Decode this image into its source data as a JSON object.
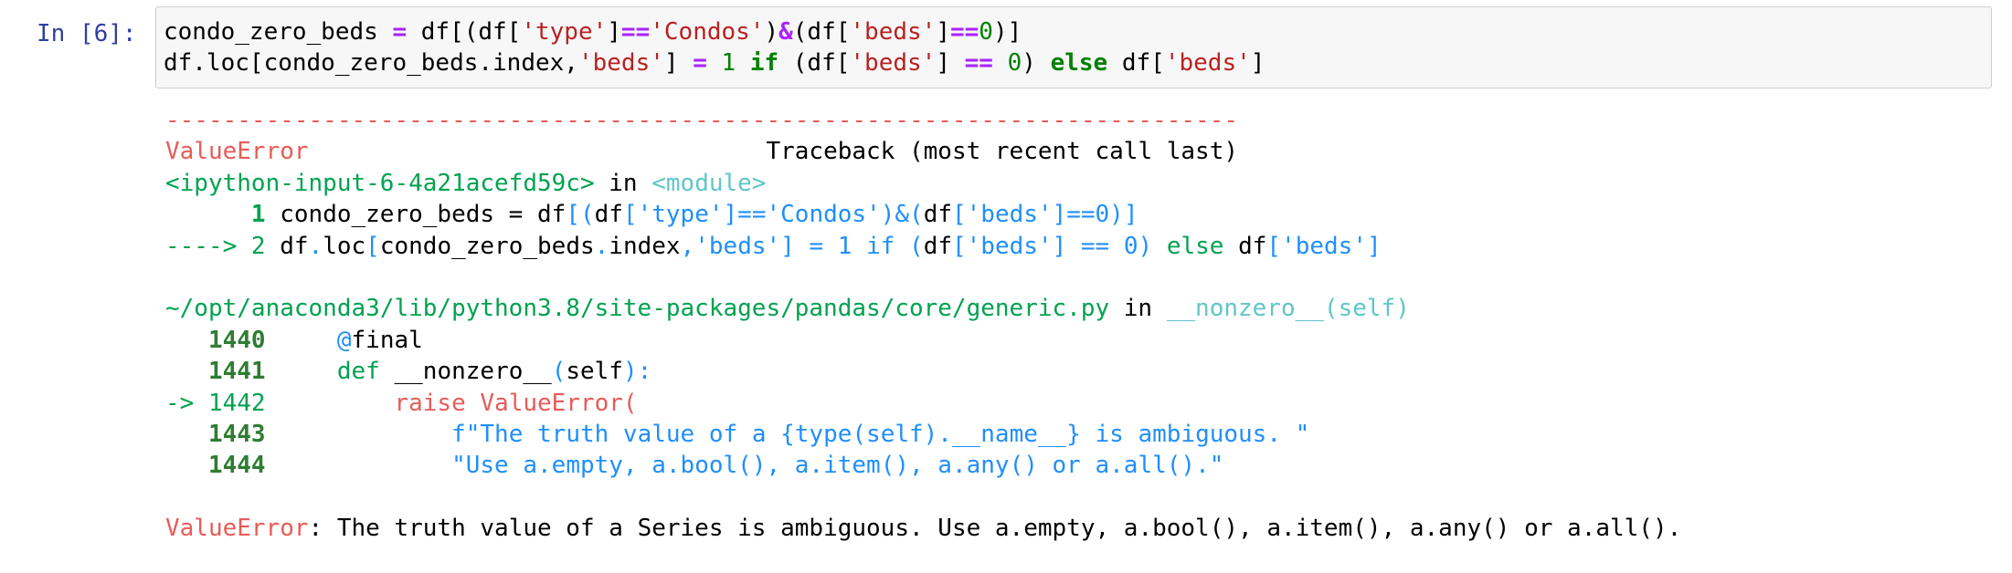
{
  "cell": {
    "prompt": "In [6]:",
    "code": [
      [
        {
          "t": "condo_zero_beds ",
          "c": "plain"
        },
        {
          "t": "=",
          "c": "op"
        },
        {
          "t": " df[(df[",
          "c": "plain"
        },
        {
          "t": "'type'",
          "c": "str"
        },
        {
          "t": "]",
          "c": "plain"
        },
        {
          "t": "==",
          "c": "op"
        },
        {
          "t": "'Condos'",
          "c": "str"
        },
        {
          "t": ")",
          "c": "plain"
        },
        {
          "t": "&",
          "c": "op"
        },
        {
          "t": "(df[",
          "c": "plain"
        },
        {
          "t": "'beds'",
          "c": "str"
        },
        {
          "t": "]",
          "c": "plain"
        },
        {
          "t": "==",
          "c": "op"
        },
        {
          "t": "0",
          "c": "num"
        },
        {
          "t": ")]",
          "c": "plain"
        }
      ],
      [
        {
          "t": "df.loc[condo_zero_beds.index,",
          "c": "plain"
        },
        {
          "t": "'beds'",
          "c": "str"
        },
        {
          "t": "] ",
          "c": "plain"
        },
        {
          "t": "=",
          "c": "op"
        },
        {
          "t": " ",
          "c": "plain"
        },
        {
          "t": "1",
          "c": "num"
        },
        {
          "t": " ",
          "c": "plain"
        },
        {
          "t": "if",
          "c": "kw"
        },
        {
          "t": " (df[",
          "c": "plain"
        },
        {
          "t": "'beds'",
          "c": "str"
        },
        {
          "t": "] ",
          "c": "plain"
        },
        {
          "t": "==",
          "c": "op"
        },
        {
          "t": " ",
          "c": "plain"
        },
        {
          "t": "0",
          "c": "num"
        },
        {
          "t": ") ",
          "c": "plain"
        },
        {
          "t": "else",
          "c": "kw"
        },
        {
          "t": " df[",
          "c": "plain"
        },
        {
          "t": "'beds'",
          "c": "str"
        },
        {
          "t": "]",
          "c": "plain"
        }
      ]
    ]
  },
  "traceback": [
    [
      {
        "t": "---------------------------------------------------------------------------",
        "c": "t-red"
      }
    ],
    [
      {
        "t": "ValueError",
        "c": "t-red"
      },
      {
        "t": "                                Traceback (most recent call last)",
        "c": "t-default"
      }
    ],
    [
      {
        "t": "<ipython-input-6-4a21acefd59c>",
        "c": "t-green"
      },
      {
        "t": " in ",
        "c": "t-default"
      },
      {
        "t": "<module>",
        "c": "t-cyan"
      }
    ],
    [
      {
        "t": "      ",
        "c": "t-default"
      },
      {
        "t": "1",
        "c": "t-bgreen"
      },
      {
        "t": " condo_zero_beds = df",
        "c": "t-default"
      },
      {
        "t": "[(",
        "c": "t-blue"
      },
      {
        "t": "df",
        "c": "t-default"
      },
      {
        "t": "['type']==",
        "c": "t-blue"
      },
      {
        "t": "'Condos'",
        "c": "t-blue"
      },
      {
        "t": ")&(",
        "c": "t-blue"
      },
      {
        "t": "df",
        "c": "t-default"
      },
      {
        "t": "['beds']==0)]",
        "c": "t-blue"
      }
    ],
    [
      {
        "t": "----> 2",
        "c": "t-green"
      },
      {
        "t": " df",
        "c": "t-default"
      },
      {
        "t": ".",
        "c": "t-blue"
      },
      {
        "t": "loc",
        "c": "t-default"
      },
      {
        "t": "[",
        "c": "t-blue"
      },
      {
        "t": "condo_zero_beds",
        "c": "t-default"
      },
      {
        "t": ".",
        "c": "t-blue"
      },
      {
        "t": "index",
        "c": "t-default"
      },
      {
        "t": ",'beds'] = 1 if (",
        "c": "t-blue"
      },
      {
        "t": "df",
        "c": "t-default"
      },
      {
        "t": "['beds'] == 0) ",
        "c": "t-blue"
      },
      {
        "t": "else",
        "c": "t-green"
      },
      {
        "t": " df",
        "c": "t-default"
      },
      {
        "t": "['beds']",
        "c": "t-blue"
      }
    ],
    [
      {
        "t": "",
        "c": "t-default"
      }
    ],
    [
      {
        "t": "~/opt/anaconda3/lib/python3.8/site-packages/pandas/core/generic.py",
        "c": "t-green"
      },
      {
        "t": " in ",
        "c": "t-default"
      },
      {
        "t": "__nonzero__(self)",
        "c": "t-cyan"
      }
    ],
    [
      {
        "t": "   ",
        "c": "t-default"
      },
      {
        "t": "1440",
        "c": "t-dgreen"
      },
      {
        "t": "     ",
        "c": "t-default"
      },
      {
        "t": "@",
        "c": "t-blue"
      },
      {
        "t": "final",
        "c": "t-default"
      }
    ],
    [
      {
        "t": "   ",
        "c": "t-default"
      },
      {
        "t": "1441",
        "c": "t-dgreen"
      },
      {
        "t": "     ",
        "c": "t-default"
      },
      {
        "t": "def",
        "c": "t-green"
      },
      {
        "t": " __nonzero__",
        "c": "t-default"
      },
      {
        "t": "(",
        "c": "t-blue"
      },
      {
        "t": "self",
        "c": "t-default"
      },
      {
        "t": "):",
        "c": "t-blue"
      }
    ],
    [
      {
        "t": "-> 1442",
        "c": "t-green"
      },
      {
        "t": "         ",
        "c": "t-default"
      },
      {
        "t": "raise",
        "c": "t-red"
      },
      {
        "t": " ValueError(",
        "c": "t-red"
      }
    ],
    [
      {
        "t": "   ",
        "c": "t-default"
      },
      {
        "t": "1443",
        "c": "t-dgreen"
      },
      {
        "t": "             ",
        "c": "t-default"
      },
      {
        "t": "f\"The truth value of a {type(self).__name__} is ambiguous. \"",
        "c": "t-blue"
      }
    ],
    [
      {
        "t": "   ",
        "c": "t-default"
      },
      {
        "t": "1444",
        "c": "t-dgreen"
      },
      {
        "t": "             ",
        "c": "t-default"
      },
      {
        "t": "\"Use a.empty, a.bool(), a.item(), a.any() or a.all().\"",
        "c": "t-blue"
      }
    ],
    [
      {
        "t": "",
        "c": "t-default"
      }
    ],
    [
      {
        "t": "ValueError",
        "c": "t-red"
      },
      {
        "t": ": The truth value of a Series is ambiguous. Use a.empty, a.bool(), a.item(), a.any() or a.all().",
        "c": "t-default"
      }
    ]
  ]
}
